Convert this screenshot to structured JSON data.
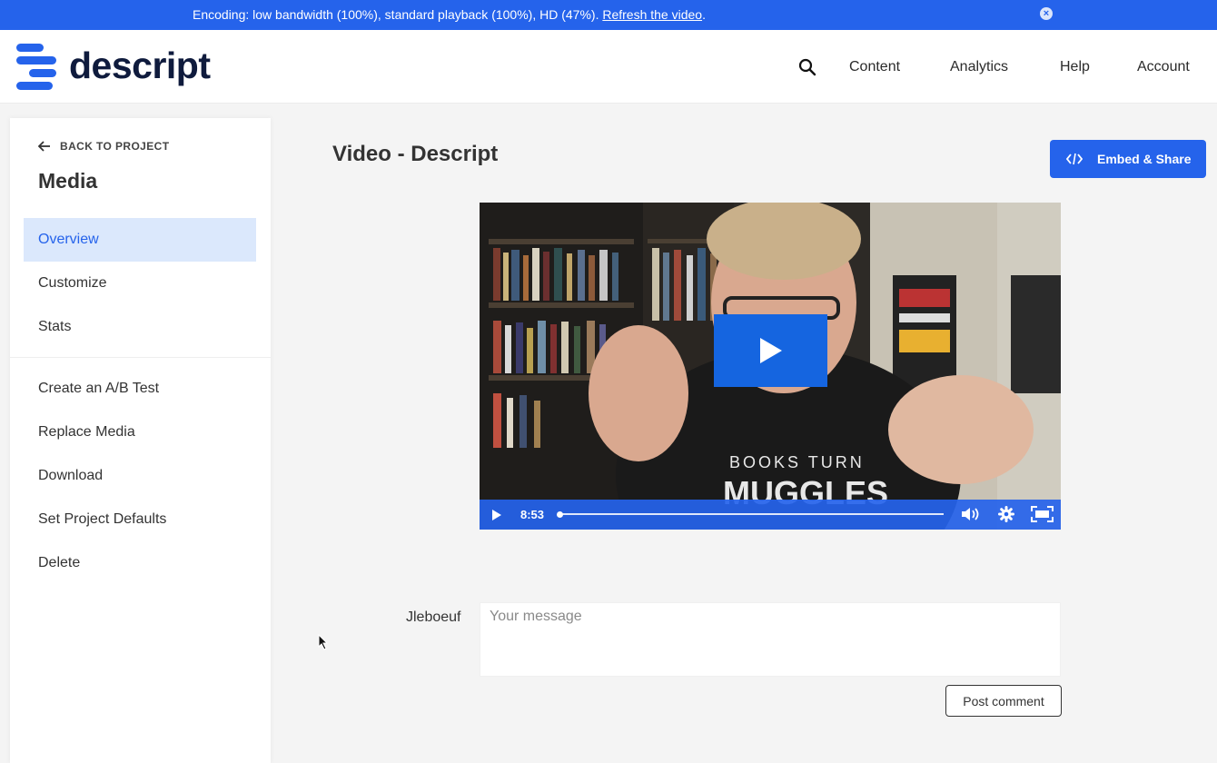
{
  "banner": {
    "message": "Encoding: low bandwidth (100%), standard playback (100%), HD (47%). ",
    "link": "Refresh the video",
    "suffix": ".",
    "close_icon": "×"
  },
  "header": {
    "brand": "descript",
    "nav": [
      "Content",
      "Analytics",
      "Help",
      "Account"
    ]
  },
  "sidebar": {
    "back_label": "BACK TO PROJECT",
    "title": "Media",
    "primary_items": [
      {
        "label": "Overview",
        "active": true
      },
      {
        "label": "Customize",
        "active": false
      },
      {
        "label": "Stats",
        "active": false
      }
    ],
    "secondary_items": [
      "Create an A/B Test",
      "Replace Media",
      "Download",
      "Set Project Defaults",
      "Delete"
    ]
  },
  "main": {
    "title": "Video - Descript",
    "embed_label": "Embed & Share",
    "video": {
      "duration": "8:53",
      "progress": 0
    },
    "comment": {
      "author": "Jleboeuf",
      "placeholder": "Your message",
      "post_label": "Post comment"
    }
  },
  "colors": {
    "accent": "#2563eb",
    "active_bg": "#dbe8fc"
  }
}
